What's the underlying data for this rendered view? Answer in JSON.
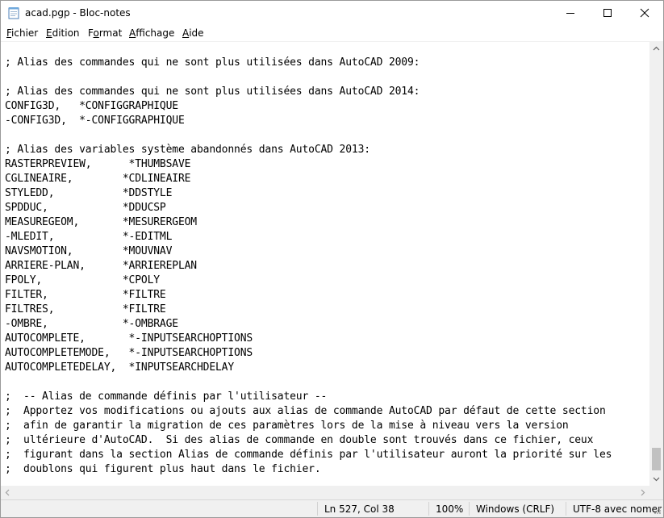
{
  "window": {
    "title": "acad.pgp - Bloc-notes",
    "icon": "notepad-icon"
  },
  "menubar": [
    {
      "label": "Fichier",
      "accel": "F",
      "rest": "ichier"
    },
    {
      "label": "Edition",
      "accel": "E",
      "rest": "dition"
    },
    {
      "label": "Format",
      "accel": "o",
      "pre": "F",
      "rest": "rmat"
    },
    {
      "label": "Affichage",
      "accel": "A",
      "rest": "ffichage"
    },
    {
      "label": "Aide",
      "accel": "A",
      "rest": "ide"
    }
  ],
  "editor": {
    "lines": [
      "",
      "; Alias des commandes qui ne sont plus utilisées dans AutoCAD 2009:",
      "",
      "; Alias des commandes qui ne sont plus utilisées dans AutoCAD 2014:",
      "CONFIG3D,   *CONFIGGRAPHIQUE",
      "-CONFIG3D,  *-CONFIGGRAPHIQUE",
      "",
      "; Alias des variables système abandonnés dans AutoCAD 2013:",
      "RASTERPREVIEW,      *THUMBSAVE",
      "CGLINEAIRE,        *CDLINEAIRE",
      "STYLEDD,           *DDSTYLE",
      "SPDDUC,            *DDUCSP",
      "MEASUREGEOM,       *MESURERGEOM",
      "-MLEDIT,           *-EDITML",
      "NAVSMOTION,        *MOUVNAV",
      "ARRIERE-PLAN,      *ARRIEREPLAN",
      "FPOLY,             *CPOLY",
      "FILTER,            *FILTRE",
      "FILTRES,           *FILTRE",
      "-OMBRE,            *-OMBRAGE",
      "AUTOCOMPLETE,       *-INPUTSEARCHOPTIONS",
      "AUTOCOMPLETEMODE,   *-INPUTSEARCHOPTIONS",
      "AUTOCOMPLETEDELAY,  *INPUTSEARCHDELAY",
      "",
      ";  -- Alias de commande définis par l'utilisateur --",
      ";  Apportez vos modifications ou ajouts aux alias de commande AutoCAD par défaut de cette section",
      ";  afin de garantir la migration de ces paramètres lors de la mise à niveau vers la version",
      ";  ultérieure d'AutoCAD.  Si des alias de commande en double sont trouvés dans ce fichier, ceux",
      ";  figurant dans la section Alias de commande définis par l'utilisateur auront la priorité sur les",
      ";  doublons qui figurent plus haut dans le fichier."
    ]
  },
  "statusbar": {
    "position": "Ln 527, Col 38",
    "zoom": "100%",
    "line_endings": "Windows (CRLF)",
    "encoding": "UTF-8 avec nomer"
  }
}
